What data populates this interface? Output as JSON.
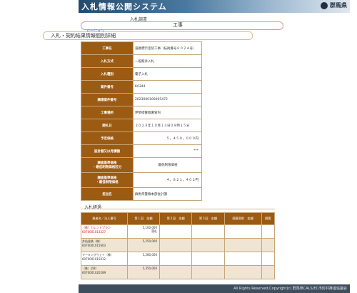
{
  "banner": {
    "title": "入札情報公開システム",
    "prefecture": "群馬県"
  },
  "header": {
    "section_label": "入札調書",
    "tab_label": "工事",
    "version_label": "バージョン",
    "page_title": "入札・契約結果情報個別詳細"
  },
  "details": [
    {
      "label": "工事名",
      "value": "道路標示塗装工事（技術番号６０２４号）",
      "align": "left"
    },
    {
      "label": "入札方式",
      "value": "一般競争入札",
      "align": "left"
    },
    {
      "label": "入札種別",
      "value": "電子入札",
      "align": "left"
    },
    {
      "label": "案件番号",
      "value": "K0344",
      "align": "left"
    },
    {
      "label": "調達案件番号",
      "value": "2023000100005472",
      "align": "left"
    },
    {
      "label": "工事場所",
      "value": "伊勢崎警察署管内",
      "align": "left"
    },
    {
      "label": "開札日",
      "value": "２０２３年１０月１３日０９時１５分",
      "align": "left"
    },
    {
      "label": "予定価格",
      "value": "５，４５０，０００円",
      "align": "right"
    },
    {
      "label": "設計額又は見積額",
      "value": "***",
      "align": "right"
    },
    {
      "label": "調査基準価格\n・最低制限価格区分",
      "value": "最低制限価格",
      "align": "center",
      "tall": true
    },
    {
      "label": "調査基準価格\n・最低制限価格",
      "value": "４，８２１，４０２円",
      "align": "right",
      "tall": true
    },
    {
      "label": "担当名",
      "value": "群馬県警察本部会計課",
      "align": "left"
    }
  ],
  "results": {
    "title": "入札経過",
    "headers": [
      "業者名／法人番号",
      "第１回　金額",
      "第２回　金額",
      "第３回　金額",
      "随意契約　金額",
      "摘要"
    ],
    "rows": [
      {
        "name": "（株）カレントプラン",
        "code": "6070001013227",
        "amount1": "5,100,000",
        "note1": "落札",
        "winner": true
      },
      {
        "name": "井仙塗装（株）",
        "code": "6070001015603",
        "amount1": "5,250,000",
        "note1": ""
      },
      {
        "name": "マーキングウェイ（株）",
        "code": "6070001015012",
        "amount1": "5,280,000",
        "note1": ""
      },
      {
        "name": "（株）浜町",
        "code": "6070001020289",
        "amount1": "5,350,000",
        "note1": ""
      }
    ]
  },
  "footer": {
    "text": "All Rights Reserved,Copyright(c) 群馬県CALS/EC市町村推進協議会"
  },
  "colors": {
    "label_bg": "#9b5b13",
    "border": "#c6a77a",
    "banner_start": "#234a6b",
    "winner_text": "#c0231f"
  }
}
